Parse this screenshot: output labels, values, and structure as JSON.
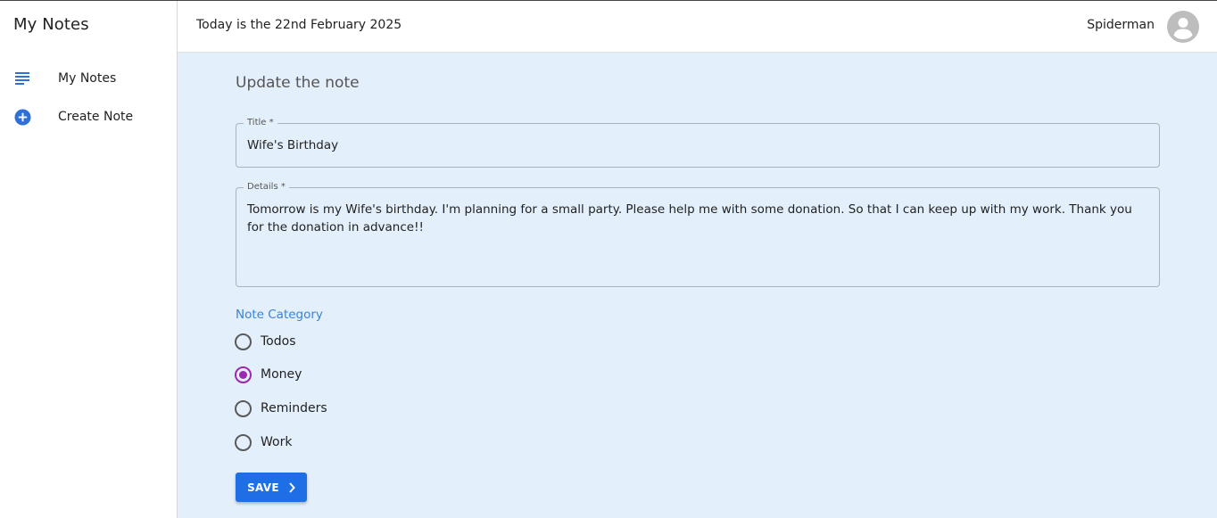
{
  "app": {
    "brand": "My Notes"
  },
  "sidebar": {
    "items": [
      {
        "label": "My Notes",
        "icon": "notes-list-icon"
      },
      {
        "label": "Create Note",
        "icon": "add-circle-icon"
      }
    ]
  },
  "header": {
    "date_text": "Today is the 22nd February 2025",
    "username": "Spiderman",
    "avatar_icon": "account-circle-icon"
  },
  "form": {
    "title": "Update the note",
    "title_field": {
      "label": "Title *",
      "value": "Wife's Birthday"
    },
    "details_field": {
      "label": "Details *",
      "value": "Tomorrow is my Wife's birthday. I'm planning for a small party. Please help me with some donation. So that I can keep up with my work. Thank you for the donation in advance!!"
    },
    "category": {
      "label": "Note Category",
      "options": [
        "Todos",
        "Money",
        "Reminders",
        "Work"
      ],
      "selected": "Money"
    },
    "save_label": "SAVE"
  },
  "colors": {
    "accent": "#1e6fe6",
    "radio_checked": "#9c27b0",
    "main_background": "#e3f0fb",
    "category_label": "#3b82d6"
  }
}
